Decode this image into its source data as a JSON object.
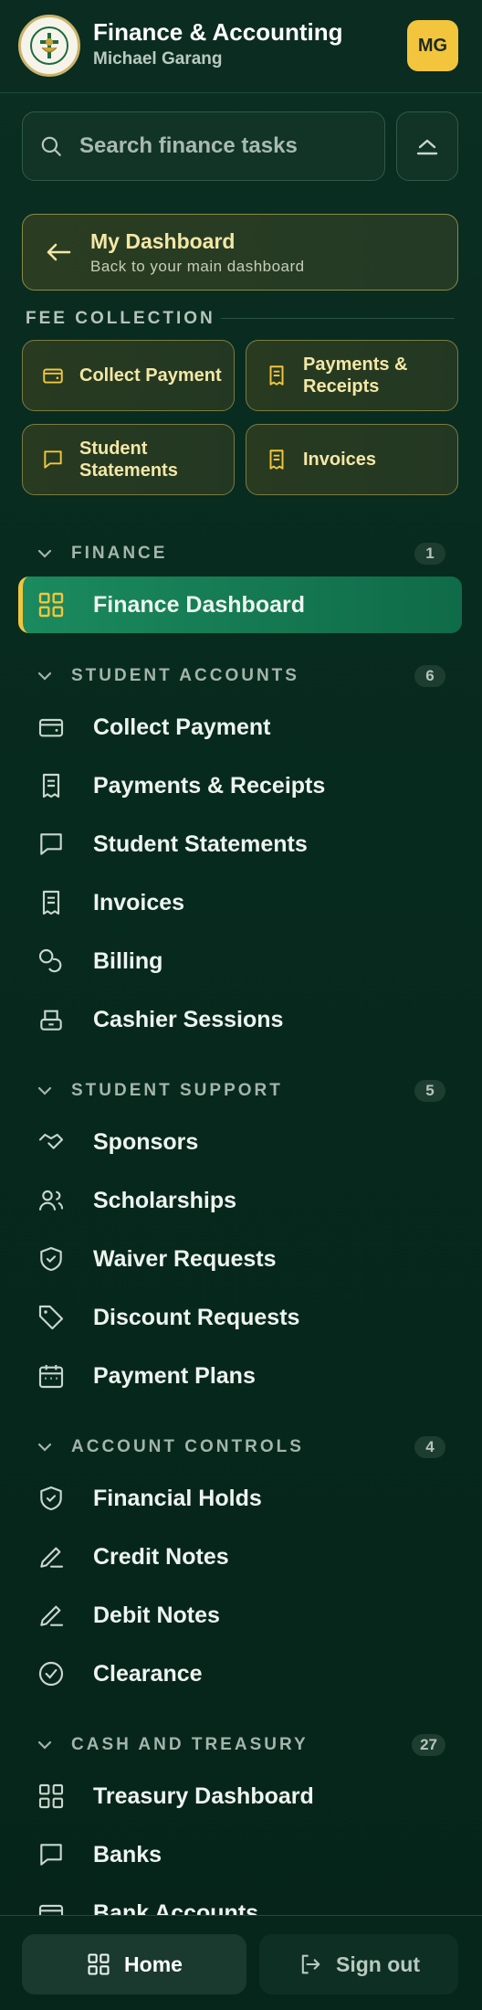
{
  "header": {
    "app_title": "Finance & Accounting",
    "user_name": "Michael Garang",
    "avatar_initials": "MG"
  },
  "search": {
    "placeholder": "Search finance tasks"
  },
  "dashboard_card": {
    "title": "My Dashboard",
    "subtitle": "Back to your main dashboard"
  },
  "fee_collection": {
    "label": "FEE COLLECTION",
    "items": [
      {
        "label": "Collect Payment",
        "icon": "wallet-icon"
      },
      {
        "label": "Payments & Receipts",
        "icon": "receipt-icon"
      },
      {
        "label": "Student Statements",
        "icon": "message-square-icon"
      },
      {
        "label": "Invoices",
        "icon": "receipt-icon"
      }
    ]
  },
  "sections": [
    {
      "title": "FINANCE",
      "count": "1",
      "items": [
        {
          "label": "Finance Dashboard",
          "icon": "grid-icon",
          "active": true
        }
      ]
    },
    {
      "title": "STUDENT ACCOUNTS",
      "count": "6",
      "items": [
        {
          "label": "Collect Payment",
          "icon": "wallet-icon"
        },
        {
          "label": "Payments & Receipts",
          "icon": "receipt-icon"
        },
        {
          "label": "Student Statements",
          "icon": "message-square-icon"
        },
        {
          "label": "Invoices",
          "icon": "receipt-icon"
        },
        {
          "label": "Billing",
          "icon": "coins-icon"
        },
        {
          "label": "Cashier Sessions",
          "icon": "cash-register-icon"
        }
      ]
    },
    {
      "title": "STUDENT SUPPORT",
      "count": "5",
      "items": [
        {
          "label": "Sponsors",
          "icon": "handshake-icon"
        },
        {
          "label": "Scholarships",
          "icon": "users-icon"
        },
        {
          "label": "Waiver Requests",
          "icon": "shield-check-icon"
        },
        {
          "label": "Discount Requests",
          "icon": "tag-icon"
        },
        {
          "label": "Payment Plans",
          "icon": "calendar-icon"
        }
      ]
    },
    {
      "title": "ACCOUNT CONTROLS",
      "count": "4",
      "items": [
        {
          "label": "Financial Holds",
          "icon": "shield-check-icon"
        },
        {
          "label": "Credit Notes",
          "icon": "pen-line-icon"
        },
        {
          "label": "Debit Notes",
          "icon": "pen-line-icon"
        },
        {
          "label": "Clearance",
          "icon": "check-circle-icon"
        }
      ]
    },
    {
      "title": "CASH AND TREASURY",
      "count": "27",
      "items": [
        {
          "label": "Treasury Dashboard",
          "icon": "grid-icon"
        },
        {
          "label": "Banks",
          "icon": "message-square-icon"
        },
        {
          "label": "Bank Accounts",
          "icon": "wallet-icon"
        }
      ]
    }
  ],
  "footer": {
    "home_label": "Home",
    "signout_label": "Sign out"
  },
  "colors": {
    "accent_gold": "#f2c53d",
    "active_green": "#1b8a5e",
    "background": "#072a1e"
  }
}
